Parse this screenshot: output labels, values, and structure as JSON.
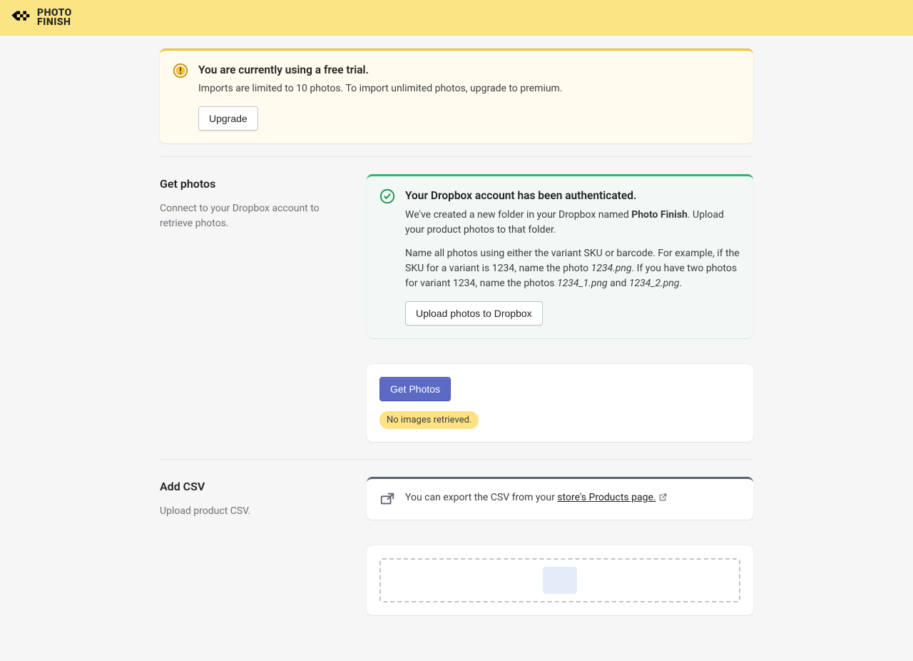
{
  "logo": {
    "line1": "PHOTO",
    "line2": "FINISH"
  },
  "trial_alert": {
    "title": "You are currently using a free trial.",
    "desc": "Imports are limited to 10 photos. To import unlimited photos, upgrade to premium.",
    "button": "Upgrade"
  },
  "get_photos": {
    "title": "Get photos",
    "desc": "Connect to your Dropbox account to retrieve photos.",
    "auth_title": "Your Dropbox account has been authenticated.",
    "auth_p1_a": "We've created a new folder in your Dropbox named ",
    "auth_p1_b": "Photo Finish",
    "auth_p1_c": ". Upload your product photos to that folder.",
    "auth_p2_a": "Name all photos using either the variant SKU or barcode. For example, if the SKU for a variant is 1234, name the photo ",
    "auth_p2_b": "1234.png",
    "auth_p2_c": ". If you have two photos for variant 1234, name the photos ",
    "auth_p2_d": "1234_1.png",
    "auth_p2_e": " and ",
    "auth_p2_f": "1234_2.png",
    "auth_p2_g": ".",
    "upload_button": "Upload photos to Dropbox",
    "get_button": "Get Photos",
    "badge": "No images retrieved."
  },
  "add_csv": {
    "title": "Add CSV",
    "desc": "Upload product CSV.",
    "info_a": "You can export the CSV from your ",
    "info_link": "store's Products page."
  }
}
